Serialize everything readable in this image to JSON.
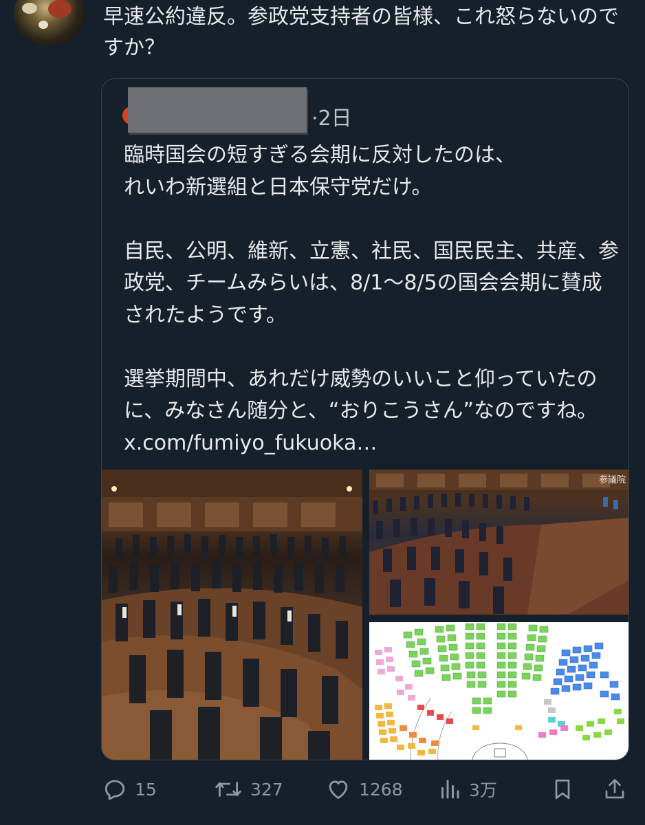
{
  "tweet": {
    "text": "早速公約違反。参政党支持者の皆様、これ怒らないのですか？"
  },
  "quote": {
    "timestamp": "·2日",
    "body": "臨時国会の短すぎる会期に反対したのは、\nれいわ新選組と日本保守党だけ。\n\n自民、公明、維新、立憲、社民、国民民主、共産、参政党、チームみらいは、8/1〜8/5の国会会期に賛成されたようです。\n\n選挙期間中、あれだけ威勢のいいこと仰っていたのに、みなさん随分と、“おりこうさん”なのですね。",
    "link": "x.com/fumiyo_fukuoka…",
    "media": {
      "seal_text": "参議院"
    }
  },
  "actions": {
    "replies": "15",
    "retweets": "327",
    "likes": "1268",
    "views": "3万"
  },
  "colors": {
    "background": "#15202b",
    "text": "#e7e9ea",
    "muted": "#8b98a5",
    "border": "#38444d"
  }
}
